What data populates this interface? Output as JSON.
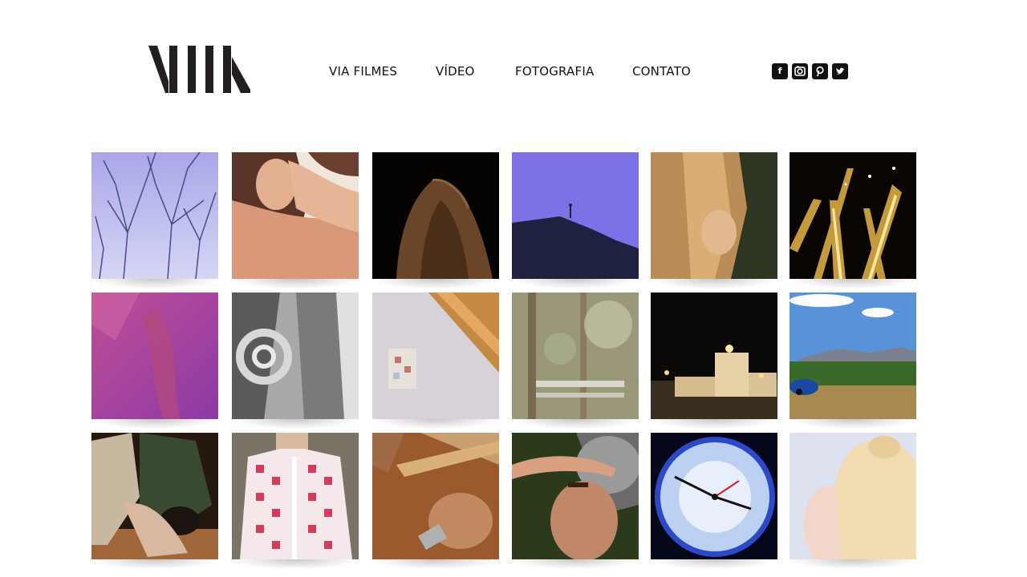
{
  "header": {
    "logo_text": "VIA",
    "nav": [
      {
        "label": "VIA FILMES"
      },
      {
        "label": "VÍDEO"
      },
      {
        "label": "FOTOGRAFIA"
      },
      {
        "label": "CONTATO"
      }
    ],
    "social": [
      {
        "icon": "facebook-icon",
        "glyph": "f"
      },
      {
        "icon": "instagram-icon",
        "glyph": ""
      },
      {
        "icon": "pinterest-icon",
        "glyph": ""
      },
      {
        "icon": "twitter-icon",
        "glyph": ""
      }
    ]
  },
  "gallery": {
    "thumbnails": [
      {
        "subject": "bare-branches-purple-sky"
      },
      {
        "subject": "woman-hand-in-hair"
      },
      {
        "subject": "cloaked-figure-dark"
      },
      {
        "subject": "hillside-purple-sky"
      },
      {
        "subject": "blonde-woman-profile"
      },
      {
        "subject": "golden-light-shafts"
      },
      {
        "subject": "magenta-abstract"
      },
      {
        "subject": "monochrome-face-spiral"
      },
      {
        "subject": "wall-corner-tile"
      },
      {
        "subject": "blurred-trees-bench"
      },
      {
        "subject": "candles-dark"
      },
      {
        "subject": "landscape-blue-car"
      },
      {
        "subject": "dancers-on-floor"
      },
      {
        "subject": "woman-embroidered-jacket"
      },
      {
        "subject": "hands-mud-wall"
      },
      {
        "subject": "man-shading-eyes"
      },
      {
        "subject": "blue-clock-face"
      },
      {
        "subject": "platinum-hair-profile"
      }
    ]
  }
}
